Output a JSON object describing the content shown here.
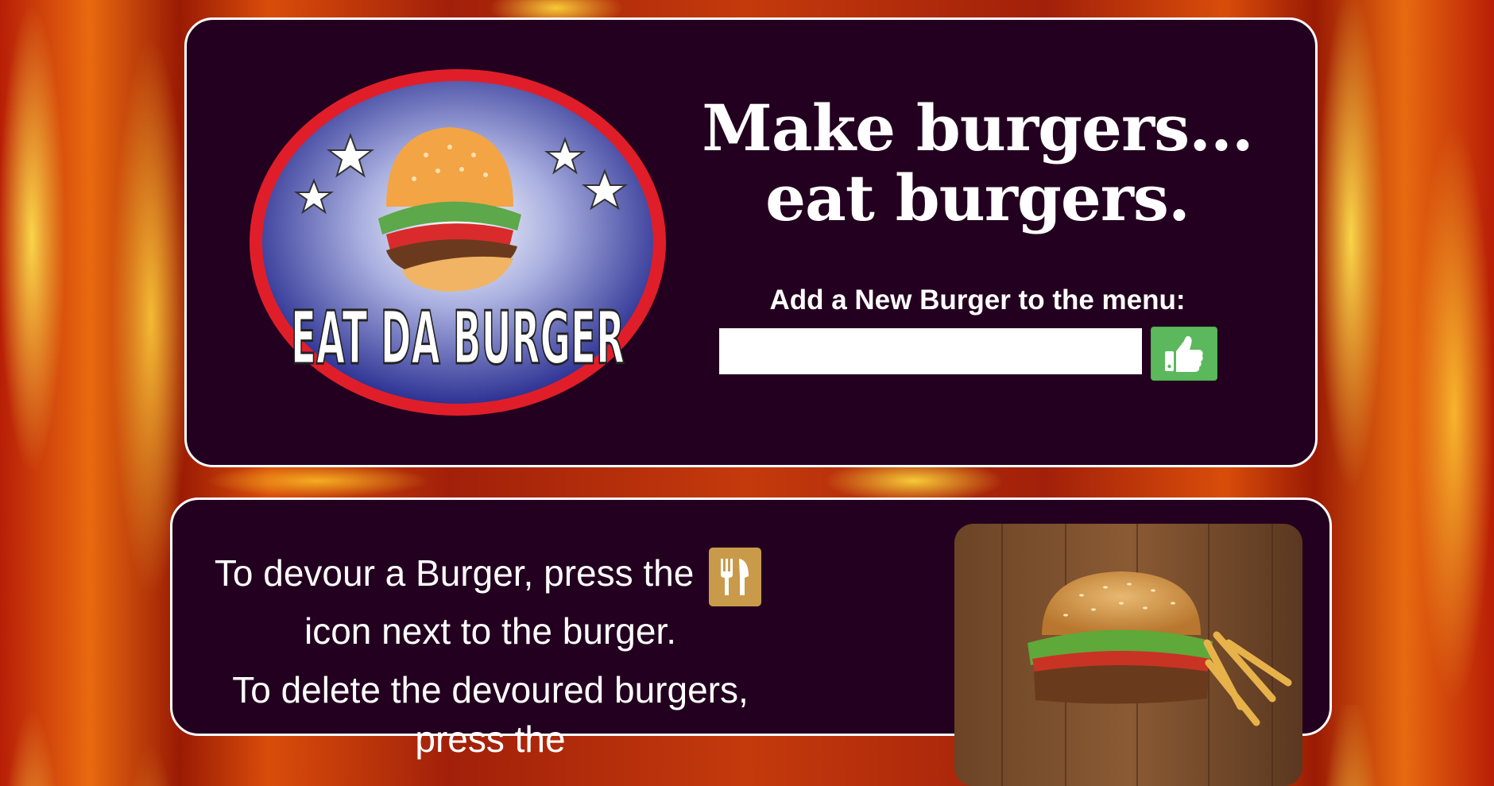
{
  "header": {
    "logo_text": "EAT DA BURGER",
    "headline_line1": "Make burgers...",
    "headline_line2": "eat burgers.",
    "add_label": "Add a New Burger to the menu:",
    "input_value": "",
    "input_placeholder": "",
    "submit_icon": "thumbs-up-icon"
  },
  "instructions": {
    "devour_before": "To devour a Burger, press the",
    "devour_icon": "fork-knife-icon",
    "devour_after": "icon next to the burger.",
    "delete_text": "To delete the devoured burgers, press the"
  },
  "colors": {
    "panel_bg": "#23001f",
    "panel_border": "#ffffff",
    "submit_green": "#5cb85c",
    "devour_icon_bg": "#c99a4a"
  }
}
